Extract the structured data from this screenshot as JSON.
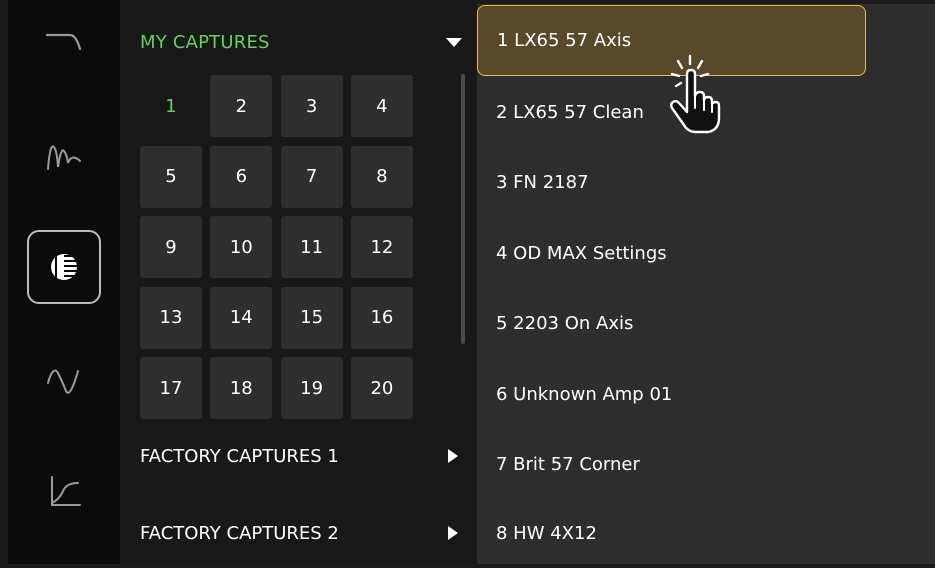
{
  "rail": {
    "icons": [
      {
        "name": "high-cut-filter-icon"
      },
      {
        "name": "waveform-eq-icon"
      },
      {
        "name": "capture-sphere-icon",
        "selected": true
      },
      {
        "name": "sine-wave-icon"
      },
      {
        "name": "low-cut-filter-icon"
      }
    ]
  },
  "folders": {
    "my_captures": {
      "label": "MY CAPTURES",
      "slots": [
        "1",
        "2",
        "3",
        "4",
        "5",
        "6",
        "7",
        "8",
        "9",
        "10",
        "11",
        "12",
        "13",
        "14",
        "15",
        "16",
        "17",
        "18",
        "19",
        "20"
      ],
      "active_slot": "1"
    },
    "factory1": {
      "label": "FACTORY CAPTURES 1"
    },
    "factory2": {
      "label": "FACTORY CAPTURES 2"
    }
  },
  "captures": {
    "items": [
      "1 LX65 57 Axis",
      "2 LX65 57 Clean",
      "3 FN 2187",
      "4 OD MAX Settings",
      "5 2203 On Axis",
      "6 Unknown Amp 01",
      "7 Brit 57 Corner",
      "8 HW 4X12"
    ],
    "selected_index": 0
  },
  "colors": {
    "accent_green": "#5fd35a",
    "selection_border": "#e3bf4d",
    "selection_fill": "#57492a"
  }
}
